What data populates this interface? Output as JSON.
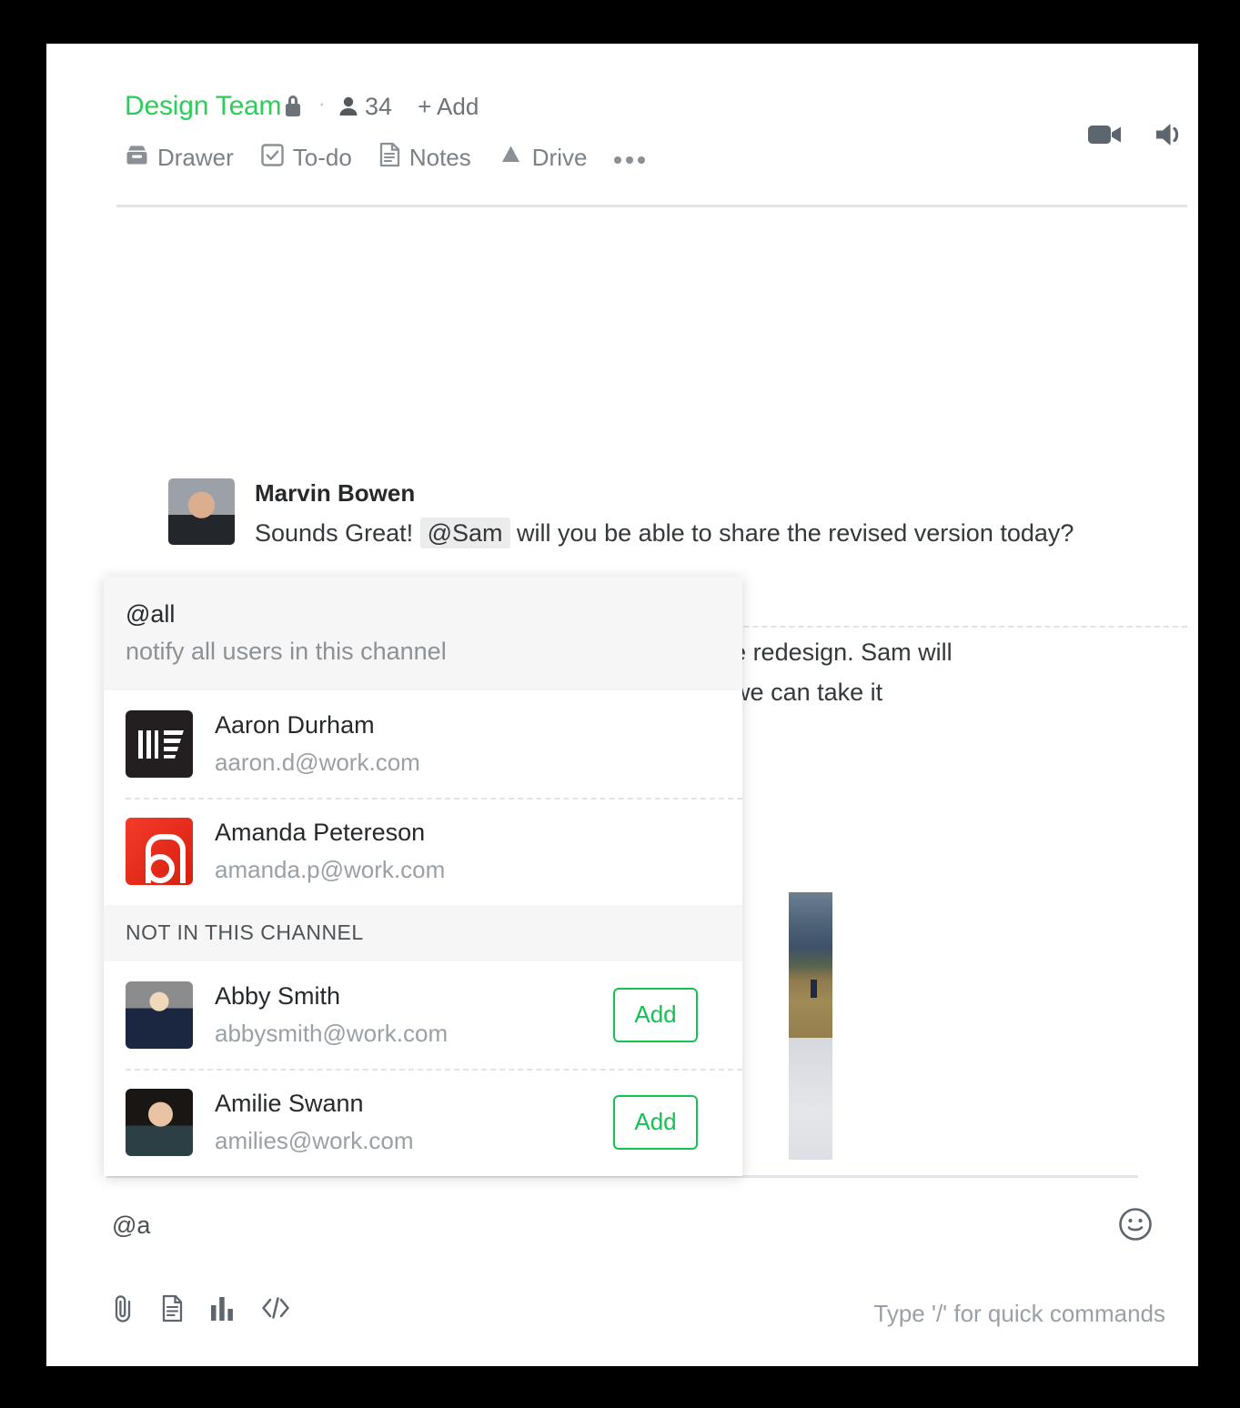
{
  "header": {
    "channel_name": "Design Team",
    "lock_icon": "lock-icon",
    "member_count": "34",
    "add_member_label": "+ Add",
    "tools": [
      {
        "icon": "drawer-icon",
        "label": "Drawer"
      },
      {
        "icon": "checkbox-icon",
        "label": "To-do"
      },
      {
        "icon": "document-icon",
        "label": "Notes"
      },
      {
        "icon": "google-drive-icon",
        "label": "Drive"
      }
    ],
    "more_icon": "ellipsis-icon",
    "actions": [
      {
        "icon": "video-camera-icon"
      },
      {
        "icon": "speaker-icon"
      }
    ]
  },
  "messages": [
    {
      "author": "Marvin Bowen",
      "avatar": "marvin-avatar",
      "text_before": "Sounds Great! ",
      "mention": "@Sam",
      "text_after": " will you be able to share the revised version today?"
    },
    {
      "author": "",
      "avatar": "",
      "text_line_1": "on the redesign. Sam will",
      "text_line_2": "then we can take it"
    }
  ],
  "mention_dropdown": {
    "all_option": {
      "handle": "@all",
      "description": "notify all users in this channel"
    },
    "in_channel": [
      {
        "name": "Aaron Durham",
        "email": "aaron.d@work.com",
        "avatar": "aaron-avatar"
      },
      {
        "name": "Amanda Petereson",
        "email": "amanda.p@work.com",
        "avatar": "amanda-avatar"
      }
    ],
    "not_in_channel_header": "NOT IN THIS CHANNEL",
    "not_in_channel": [
      {
        "name": "Abby Smith",
        "email": "abbysmith@work.com",
        "avatar": "abby-avatar",
        "action_label": "Add"
      },
      {
        "name": "Amilie Swann",
        "email": "amilies@work.com",
        "avatar": "amilie-avatar",
        "action_label": "Add"
      }
    ]
  },
  "composer": {
    "value": "@a",
    "placeholder": "",
    "emoji_icon": "smiley-icon",
    "toolbar": [
      {
        "icon": "paperclip-icon"
      },
      {
        "icon": "document-icon"
      },
      {
        "icon": "bar-chart-icon"
      },
      {
        "icon": "code-icon"
      }
    ],
    "hint": "Type '/' for quick commands"
  },
  "colors": {
    "brand_green": "#2ecc59",
    "add_button_green": "#14c254",
    "text_primary": "#26292b",
    "text_muted": "#9aa0a5"
  }
}
